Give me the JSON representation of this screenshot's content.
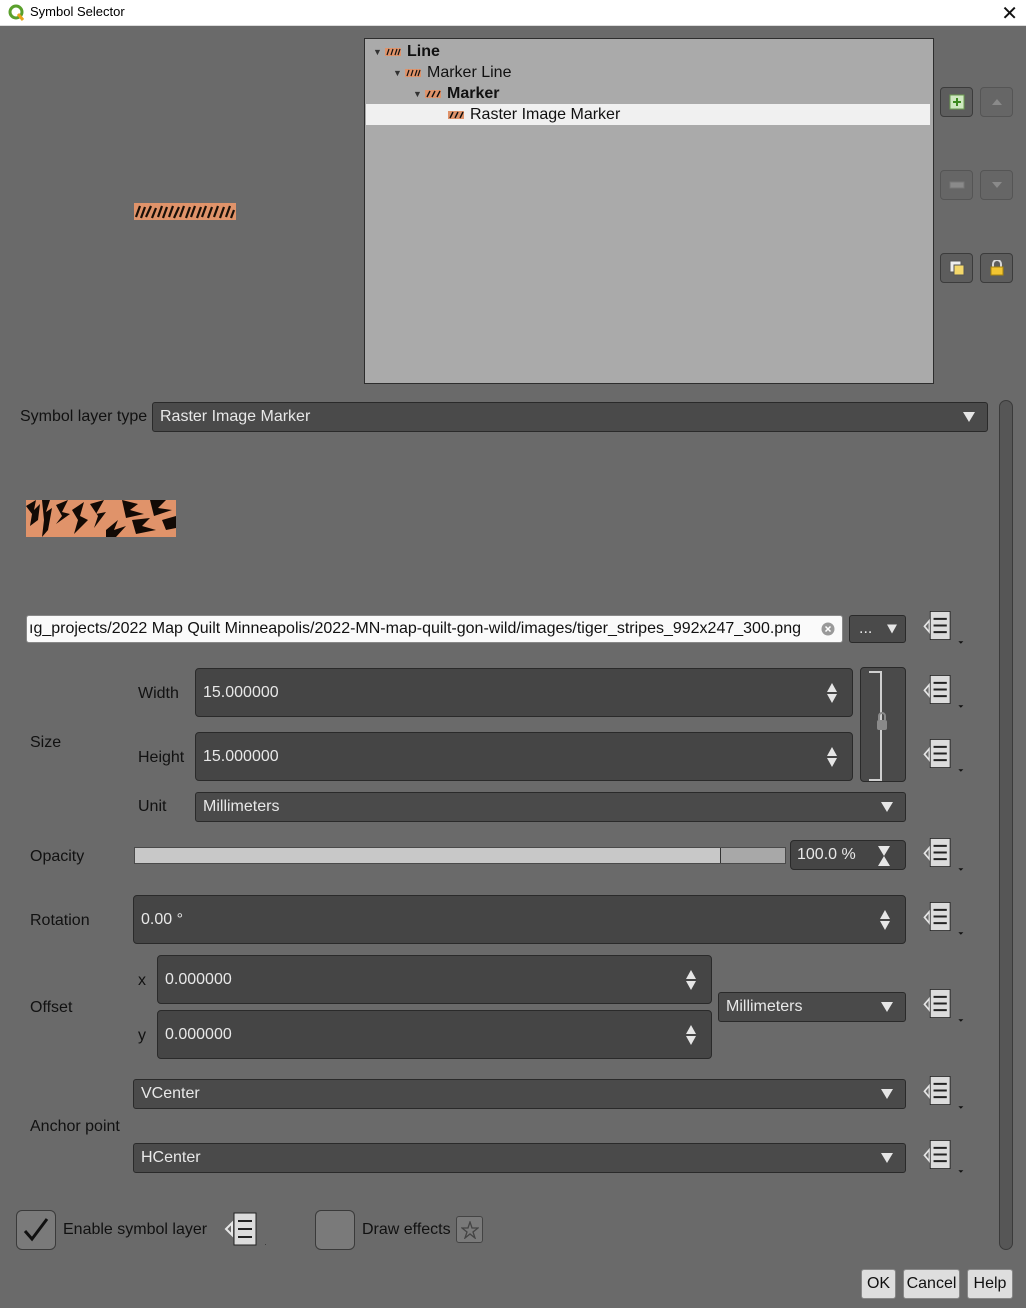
{
  "window": {
    "title": "Symbol Selector",
    "close_glyph": "✕",
    "app_icon": "qgis-icon"
  },
  "tree": {
    "items": [
      {
        "label": "Line",
        "bold": true,
        "level": 0
      },
      {
        "label": "Marker Line",
        "bold": false,
        "level": 1
      },
      {
        "label": "Marker",
        "bold": true,
        "level": 2
      },
      {
        "label": "Raster Image Marker",
        "bold": false,
        "level": 3,
        "selected": true
      }
    ]
  },
  "side_buttons": [
    "add-layer-icon",
    "move-up-icon",
    "remove-layer-icon",
    "move-down-icon",
    "duplicate-layer-icon",
    "lock-color-icon"
  ],
  "symbol_layer_type": {
    "label": "Symbol layer type",
    "value": "Raster Image Marker"
  },
  "file": {
    "path": "ıg_projects/2022 Map Quilt Minneapolis/2022-MN-map-quilt-gon-wild/images/tiger_stripes_992x247_300.png",
    "browse_label": "..."
  },
  "size": {
    "label": "Size",
    "width_label": "Width",
    "width_value": "15.000000",
    "height_label": "Height",
    "height_value": "15.000000",
    "unit_label": "Unit",
    "unit_value": "Millimeters"
  },
  "opacity": {
    "label": "Opacity",
    "value": "100.0 %",
    "fraction": 1.0
  },
  "rotation": {
    "label": "Rotation",
    "value": "0.00 °"
  },
  "offset": {
    "label": "Offset",
    "x_label": "x",
    "x_value": "0.000000",
    "y_label": "y",
    "y_value": "0.000000",
    "unit_value": "Millimeters"
  },
  "anchor": {
    "label": "Anchor point",
    "vertical": "VCenter",
    "horizontal": "HCenter"
  },
  "enable_layer": {
    "label": "Enable symbol layer",
    "checked": true
  },
  "draw_effects": {
    "label": "Draw effects",
    "checked": false
  },
  "buttons": {
    "ok": "OK",
    "cancel": "Cancel",
    "help": "Help"
  },
  "colors": {
    "background": "#6a6a6a",
    "tree_bg": "#aaaaaa",
    "field_bg": "#454545",
    "tiger_orange": "#e0936a"
  }
}
